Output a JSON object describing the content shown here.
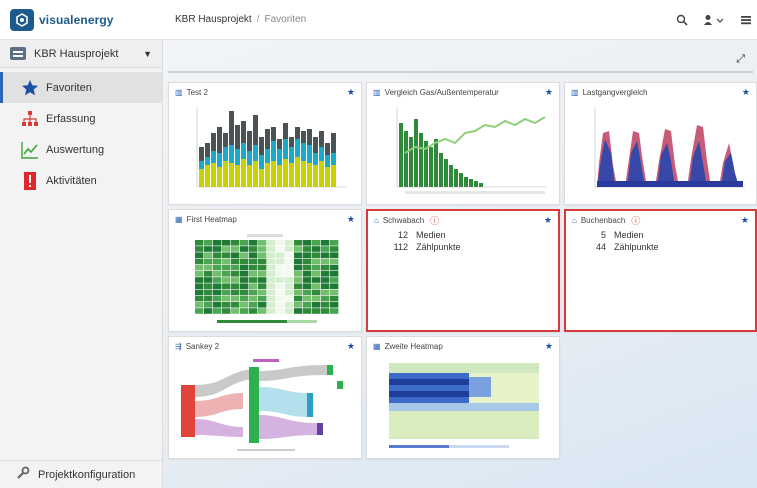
{
  "header": {
    "logo_text": "visualenergy",
    "breadcrumb": {
      "project": "KBR Hausprojekt",
      "separator": "/",
      "current": "Favoriten"
    },
    "icons": [
      "search-icon",
      "user-icon",
      "menu-icon"
    ]
  },
  "sidebar": {
    "project_label": "KBR Hausprojekt",
    "items": [
      {
        "label": "Favoriten",
        "icon": "star-icon",
        "active": true
      },
      {
        "label": "Erfassung",
        "icon": "network-icon"
      },
      {
        "label": "Auswertung",
        "icon": "line-chart-icon"
      },
      {
        "label": "Aktivitäten",
        "icon": "alert-icon"
      }
    ],
    "footer_label": "Projektkonfiguration"
  },
  "tiles": {
    "test2": {
      "title": "Test 2"
    },
    "gas": {
      "title": "Vergleich Gas/Außentemperatur"
    },
    "lastgang": {
      "title": "Lastgangvergleich"
    },
    "heatmap1": {
      "title": "First Heatmap"
    },
    "schwabach": {
      "title": "Schwabach",
      "rows": [
        {
          "value": "12",
          "label": "Medien"
        },
        {
          "value": "112",
          "label": "Zählpunkte"
        }
      ]
    },
    "buchenbach": {
      "title": "Buchenbach",
      "rows": [
        {
          "value": "5",
          "label": "Medien"
        },
        {
          "value": "44",
          "label": "Zählpunkte"
        }
      ]
    },
    "sankey": {
      "title": "Sankey 2"
    },
    "heatmap2": {
      "title": "Zweite Heatmap"
    }
  },
  "colors": {
    "accent": "#2a63b7",
    "alert": "#d63a3a",
    "logo": "#1d5a8c"
  }
}
